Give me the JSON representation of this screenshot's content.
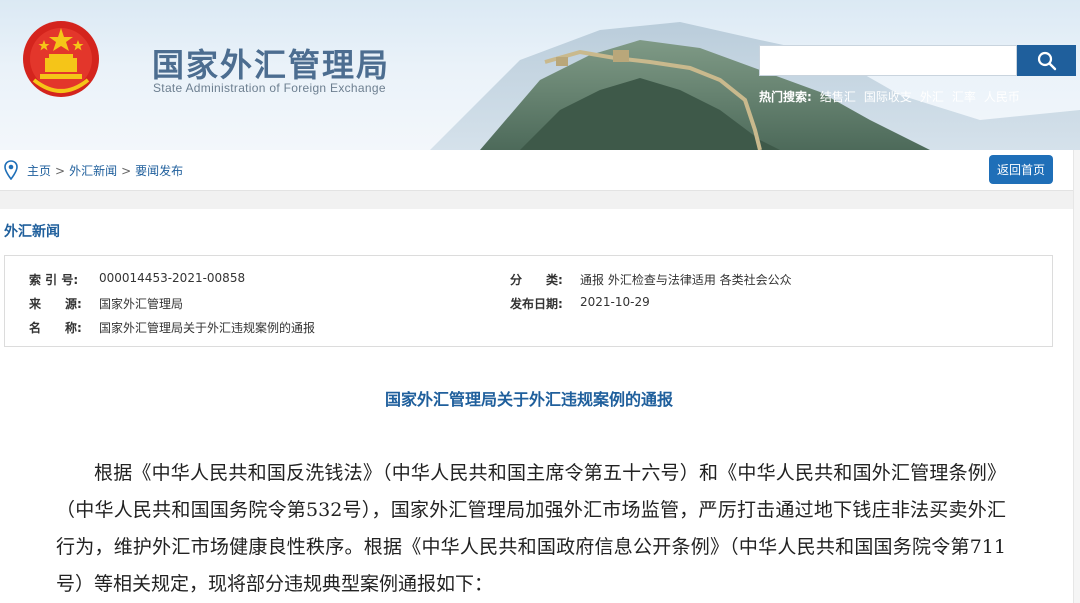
{
  "header": {
    "logo_cn": "国家外汇管理局",
    "logo_en": "State Administration of Foreign Exchange",
    "search_placeholder": "",
    "hot_label": "热门搜索:",
    "hot_links": [
      "结售汇",
      "国际收支",
      "外汇",
      "汇率",
      "人民币"
    ]
  },
  "breadcrumb": {
    "items": [
      "主页",
      "外汇新闻",
      "要闻发布"
    ],
    "separator": ">"
  },
  "back_button": "返回首页",
  "section_title": "外汇新闻",
  "meta": {
    "index_label": "索 引 号:",
    "index_value": "000014453-2021-00858",
    "category_label": "分　　类:",
    "category_value": "通报  外汇检查与法律适用  各类社会公众",
    "source_label": "来　　源:",
    "source_value": "国家外汇管理局",
    "date_label": "发布日期:",
    "date_value": "2021-10-29",
    "name_label": "名　　称:",
    "name_value": "国家外汇管理局关于外汇违规案例的通报"
  },
  "doc_title": "国家外汇管理局关于外汇违规案例的通报",
  "body_paragraph": "根据《中华人民共和国反洗钱法》（中华人民共和国主席令第五十六号）和《中华人民共和国外汇管理条例》（中华人民共和国国务院令第532号），国家外汇管理局加强外汇市场监管，严厉打击通过地下钱庄非法买卖外汇行为，维护外汇市场健康良性秩序。根据《中华人民共和国政府信息公开条例》（中华人民共和国国务院令第711号）等相关规定，现将部分违规典型案例通报如下：",
  "colors": {
    "accent": "#1f5f9c",
    "button": "#1f6fb8"
  }
}
